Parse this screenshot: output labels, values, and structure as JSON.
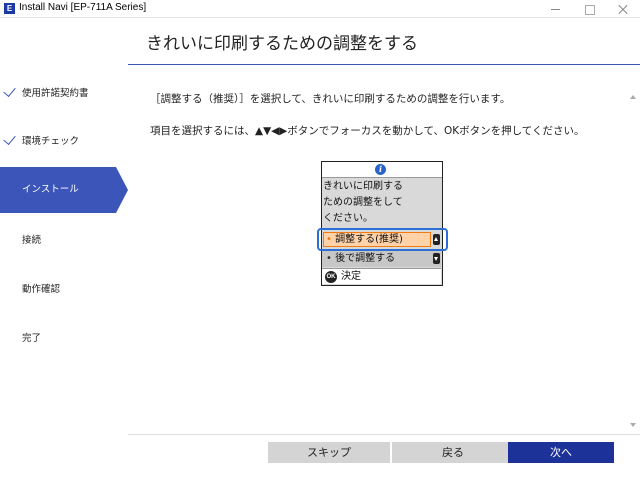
{
  "window": {
    "icon_letter": "E",
    "title": "Install Navi [EP-711A Series]"
  },
  "sidebar": {
    "items": [
      {
        "label": "使用許諾契約書",
        "state": "done"
      },
      {
        "label": "環境チェック",
        "state": "done"
      },
      {
        "label": "インストール",
        "state": "active"
      },
      {
        "label": "接続",
        "state": "pending"
      },
      {
        "label": "動作確認",
        "state": "pending"
      },
      {
        "label": "完了",
        "state": "pending"
      }
    ]
  },
  "main": {
    "title": "きれいに印刷するための調整をする",
    "para1": "［調整する（推奨）］を選択して、きれいに印刷するための調整を行います。",
    "para2": "項目を選択するには、▲▼◀▶ボタンでフォーカスを動かして、OKボタンを押してください。"
  },
  "lcd": {
    "info_icon": "i",
    "message": [
      "きれいに印刷する",
      "ための調整をして",
      "ください。"
    ],
    "options": [
      "調整する(推奨)",
      "後で調整する"
    ],
    "ok_icon": "OK",
    "ok_label": "決定"
  },
  "buttons": {
    "skip": "スキップ",
    "back": "戻る",
    "next": "次へ"
  },
  "colors": {
    "accent": "#3c55b9",
    "primary_button": "#1c3298",
    "focus": "#2b6fd6",
    "highlight": "#f07a13"
  }
}
